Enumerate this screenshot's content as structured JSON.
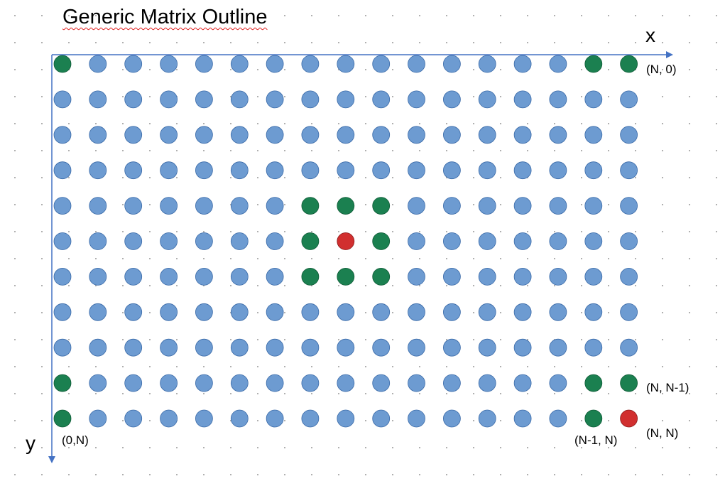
{
  "title": "Generic Matrix Outline",
  "axes": {
    "x_label": "x",
    "y_label": "y"
  },
  "grid": {
    "columns": 17,
    "rows": 11
  },
  "colors": {
    "default": "#6d9bd1",
    "default_stroke": "#3a6aa8",
    "highlight": "#1b8050",
    "highlight_stroke": "#0f5a36",
    "target": "#d12f2f",
    "target_stroke": "#8a1a1a",
    "axis": "#4472c4"
  },
  "highlight_cells": [
    [
      0,
      0
    ],
    [
      15,
      0
    ],
    [
      16,
      0
    ],
    [
      7,
      4
    ],
    [
      8,
      4
    ],
    [
      9,
      4
    ],
    [
      7,
      5
    ],
    [
      9,
      5
    ],
    [
      7,
      6
    ],
    [
      8,
      6
    ],
    [
      9,
      6
    ],
    [
      0,
      9
    ],
    [
      15,
      9
    ],
    [
      16,
      9
    ],
    [
      0,
      10
    ],
    [
      15,
      10
    ]
  ],
  "target_cells": [
    [
      8,
      5
    ],
    [
      16,
      10
    ]
  ],
  "labels": {
    "top_right": "(N, 0)",
    "right_second_last": "(N, N-1)",
    "bottom_right": "(N, N)",
    "bottom_second_last": "(N-1, N)",
    "bottom_left": "(0,N)"
  }
}
